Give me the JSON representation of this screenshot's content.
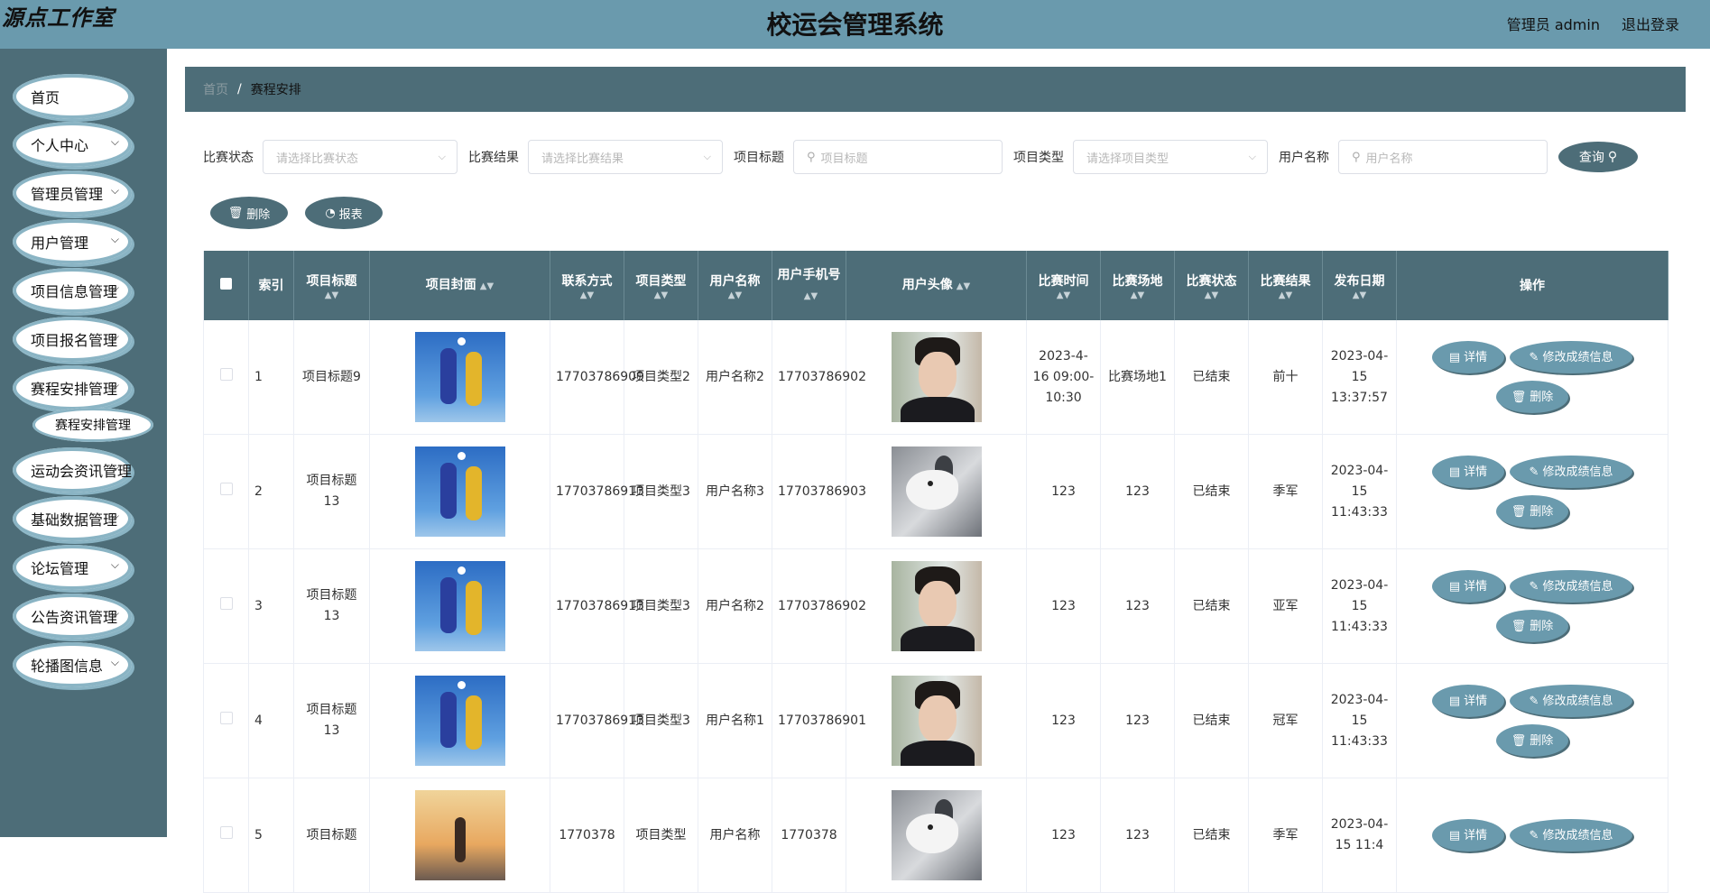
{
  "header": {
    "logo": "源点工作室",
    "title": "校运会管理系统",
    "user": "管理员 admin",
    "logout": "退出登录"
  },
  "sidebar": {
    "items": [
      {
        "label": "首页",
        "chevron": false
      },
      {
        "label": "个人中心",
        "chevron": true
      },
      {
        "label": "管理员管理",
        "chevron": true
      },
      {
        "label": "用户管理",
        "chevron": true
      },
      {
        "label": "项目信息管理",
        "chevron": true
      },
      {
        "label": "项目报名管理",
        "chevron": true
      },
      {
        "label": "赛程安排管理",
        "chevron": true
      },
      {
        "label": "运动会资讯管理",
        "chevron": true
      },
      {
        "label": "基础数据管理",
        "chevron": true
      },
      {
        "label": "论坛管理",
        "chevron": true
      },
      {
        "label": "公告资讯管理",
        "chevron": true
      },
      {
        "label": "轮播图信息",
        "chevron": true
      }
    ],
    "submenu": "赛程安排管理"
  },
  "breadcrumb": {
    "home": "首页",
    "sep": "/",
    "current": "赛程安排"
  },
  "search": {
    "status_label": "比赛状态",
    "status_placeholder": "请选择比赛状态",
    "result_label": "比赛结果",
    "result_placeholder": "请选择比赛结果",
    "title_label": "项目标题",
    "title_placeholder": "项目标题",
    "type_label": "项目类型",
    "type_placeholder": "请选择项目类型",
    "user_label": "用户名称",
    "user_placeholder": "用户名称",
    "query": "查询"
  },
  "actions": {
    "delete": "删除",
    "report": "报表"
  },
  "table": {
    "headers": {
      "index": "索引",
      "title": "项目标题",
      "cover": "项目封面",
      "contact": "联系方式",
      "type": "项目类型",
      "username": "用户名称",
      "phone": "用户手机号",
      "avatar": "用户头像",
      "time": "比赛时间",
      "venue": "比赛场地",
      "status": "比赛状态",
      "result": "比赛结果",
      "date": "发布日期",
      "ops": "操作"
    },
    "op_labels": {
      "detail": "详情",
      "edit": "修改成绩信息",
      "delete": "删除"
    },
    "rows": [
      {
        "index": "1",
        "title": "项目标题9",
        "cover": "soccer",
        "contact": "17703786909",
        "type": "项目类型2",
        "username": "用户名称2",
        "phone": "17703786902",
        "avatar": "man",
        "time": "2023-4-16 09:00-10:30",
        "venue": "比赛场地1",
        "status": "已结束",
        "result": "前十",
        "date": "2023-04-15 13:37:57"
      },
      {
        "index": "2",
        "title": "项目标题13",
        "cover": "soccer",
        "contact": "17703786913",
        "type": "项目类型3",
        "username": "用户名称3",
        "phone": "17703786903",
        "avatar": "dog",
        "time": "123",
        "venue": "123",
        "status": "已结束",
        "result": "季军",
        "date": "2023-04-15 11:43:33"
      },
      {
        "index": "3",
        "title": "项目标题13",
        "cover": "soccer",
        "contact": "17703786913",
        "type": "项目类型3",
        "username": "用户名称2",
        "phone": "17703786902",
        "avatar": "man",
        "time": "123",
        "venue": "123",
        "status": "已结束",
        "result": "亚军",
        "date": "2023-04-15 11:43:33"
      },
      {
        "index": "4",
        "title": "项目标题13",
        "cover": "soccer",
        "contact": "17703786913",
        "type": "项目类型3",
        "username": "用户名称1",
        "phone": "17703786901",
        "avatar": "man",
        "time": "123",
        "venue": "123",
        "status": "已结束",
        "result": "冠军",
        "date": "2023-04-15 11:43:33"
      },
      {
        "index": "5",
        "title": "项目标题",
        "cover": "sunset",
        "contact": "1770378",
        "type": "项目类型",
        "username": "用户名称",
        "phone": "1770378",
        "avatar": "dog",
        "time": "123",
        "venue": "123",
        "status": "已结束",
        "result": "季军",
        "date": "2023-04-15 11:4"
      }
    ]
  }
}
